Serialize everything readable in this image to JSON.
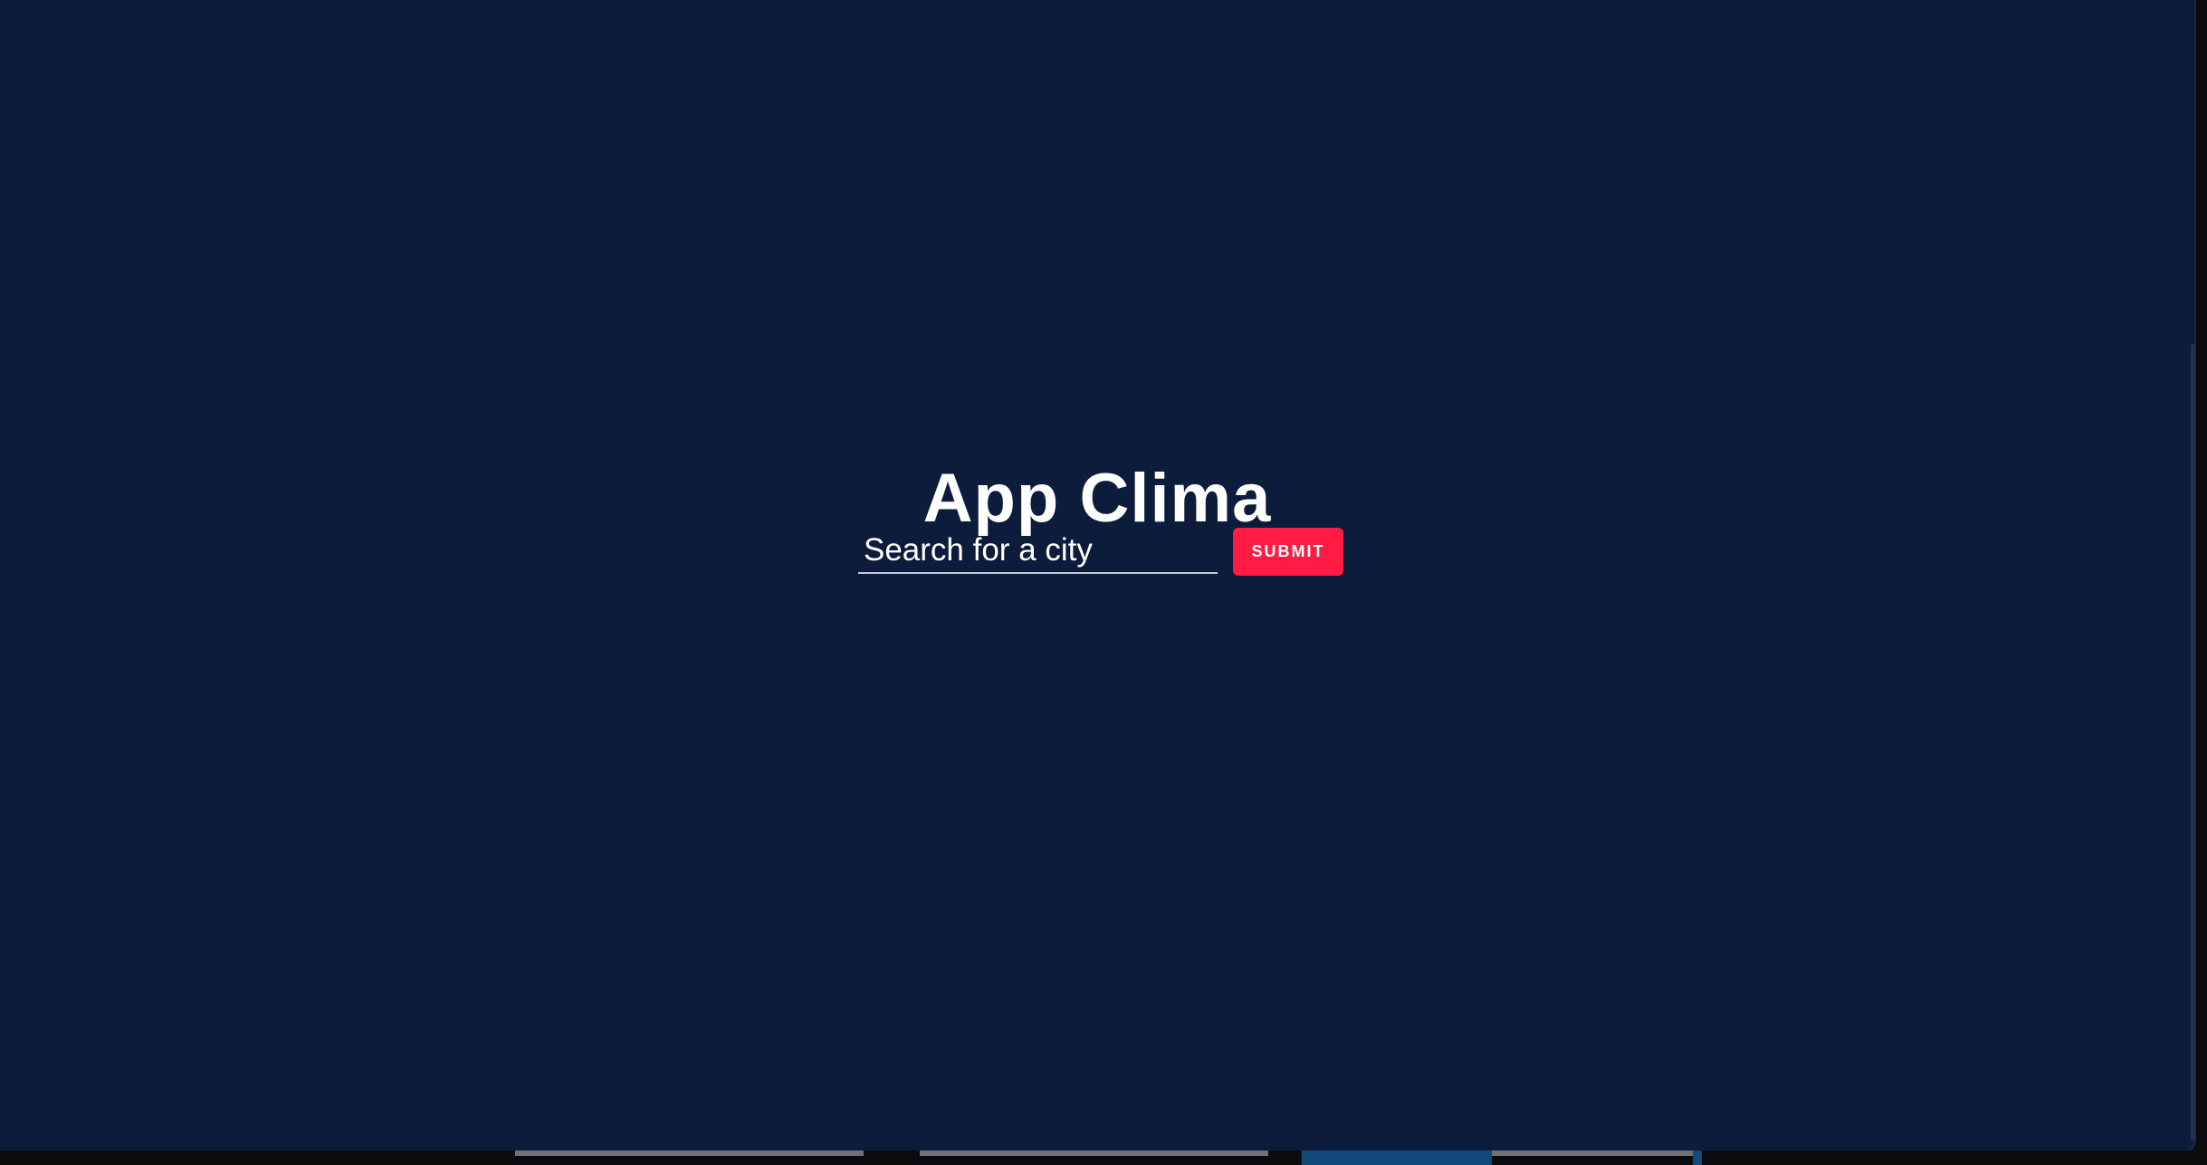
{
  "app": {
    "title": "App Clima"
  },
  "search": {
    "placeholder": "Search for a city",
    "value": ""
  },
  "submit": {
    "label": "SUBMIT"
  },
  "colors": {
    "background": "#0d1c3b",
    "accent": "#ff1b44",
    "text": "#ffffff"
  }
}
